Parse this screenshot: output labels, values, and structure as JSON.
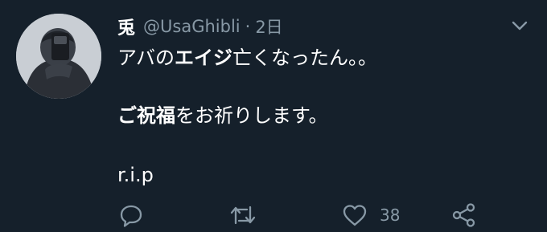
{
  "tweet": {
    "display_name": "兎",
    "handle": "@UsaGhibli",
    "separator": "·",
    "time": "2日",
    "line1_a": "アバの",
    "line1_b": "エイジ",
    "line1_c": "亡くなったん。。",
    "line2_a": "ご祝福",
    "line2_b": "をお祈りします。",
    "line3": "r.i.p",
    "like_count": "38"
  },
  "icons": {
    "reply": "reply-icon",
    "retweet": "retweet-icon",
    "like": "heart-icon",
    "share": "share-icon",
    "menu": "chevron-down-icon"
  },
  "colors": {
    "background": "#15202b",
    "muted": "#8899a6",
    "text": "#ffffff"
  }
}
